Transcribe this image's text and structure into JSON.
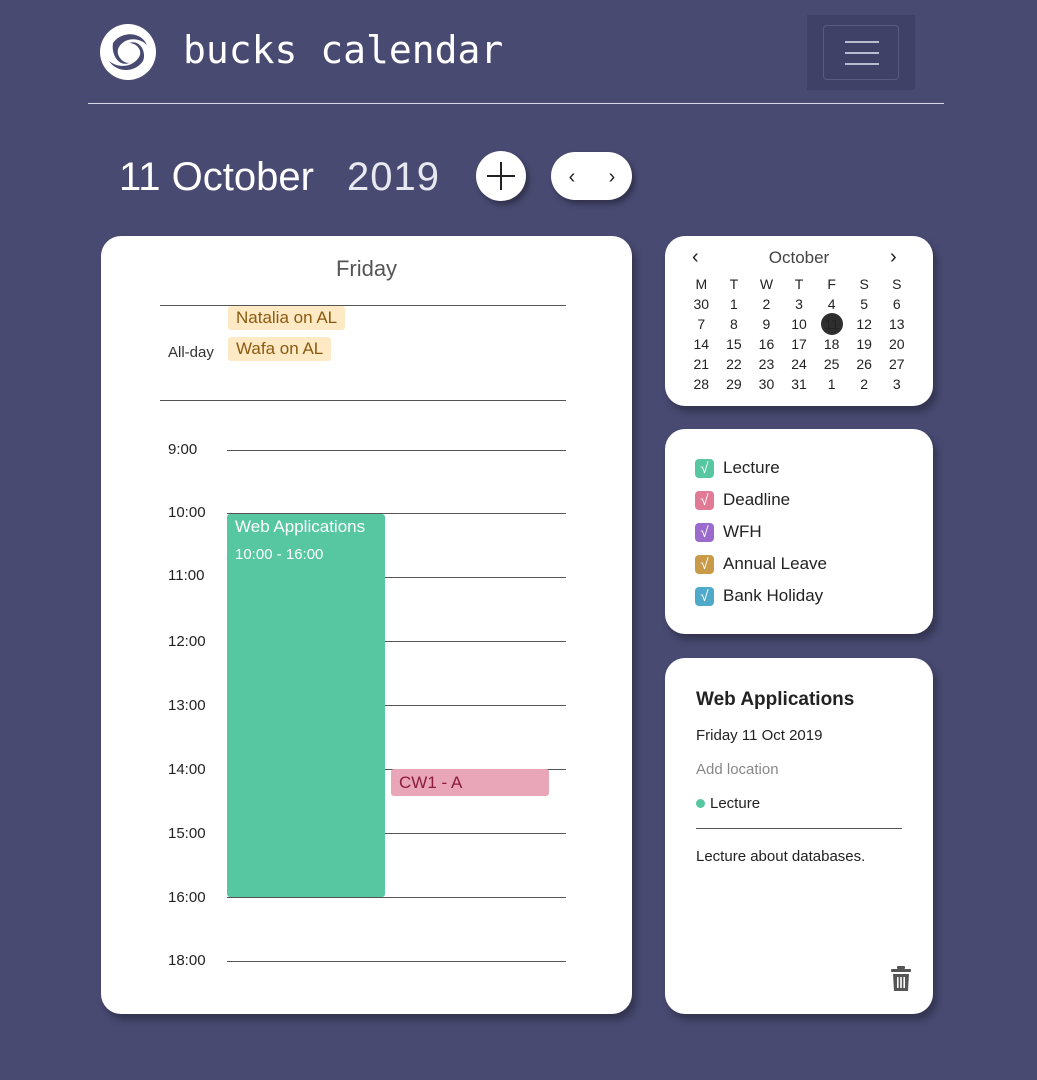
{
  "header": {
    "app_title": "bucks calendar",
    "logo_icon": "bucks-logo-icon",
    "menu_icon": "hamburger-menu-icon"
  },
  "date_heading": {
    "day_month": "11 October",
    "year": "2019",
    "add_icon": "plus-icon",
    "prev_icon": "chevron-left-icon",
    "next_icon": "chevron-right-icon",
    "prev_glyph": "‹",
    "next_glyph": "›"
  },
  "day_view": {
    "day_name": "Friday",
    "allday_label": "All-day",
    "allday_events": [
      {
        "label": "Natalia on AL"
      },
      {
        "label": "Wafa on AL"
      }
    ],
    "time_labels": [
      "9:00",
      "10:00",
      "11:00",
      "12:00",
      "13:00",
      "14:00",
      "15:00",
      "16:00",
      "18:00"
    ],
    "events": [
      {
        "title": "Web Applications",
        "time": "10:00 - 16:00",
        "category": "Lecture"
      },
      {
        "title": "CW1 - A",
        "category": "Deadline"
      }
    ]
  },
  "mini_calendar": {
    "month": "October",
    "prev_glyph": "‹",
    "next_glyph": "›",
    "weekdays": [
      "M",
      "T",
      "W",
      "T",
      "F",
      "S",
      "S"
    ],
    "weeks": [
      [
        "30",
        "1",
        "2",
        "3",
        "4",
        "5",
        "6"
      ],
      [
        "7",
        "8",
        "9",
        "10",
        "11",
        "12",
        "13"
      ],
      [
        "14",
        "15",
        "16",
        "17",
        "18",
        "19",
        "20"
      ],
      [
        "21",
        "22",
        "23",
        "24",
        "25",
        "26",
        "27"
      ],
      [
        "28",
        "29",
        "30",
        "31",
        "1",
        "2",
        "3"
      ]
    ],
    "today": "11"
  },
  "legend": {
    "check_glyph": "√",
    "items": [
      {
        "label": "Lecture",
        "color": "#56c7a1"
      },
      {
        "label": "Deadline",
        "color": "#e07a95"
      },
      {
        "label": "WFH",
        "color": "#9a6bcc"
      },
      {
        "label": "Annual Leave",
        "color": "#c99a48"
      },
      {
        "label": "Bank Holiday",
        "color": "#4fa9c9"
      }
    ]
  },
  "event_detail": {
    "title": "Web Applications",
    "date": "Friday 11 Oct 2019",
    "location_placeholder": "Add location",
    "category": "Lecture",
    "category_color": "#56c7a1",
    "description": "Lecture about databases.",
    "delete_icon": "trash-icon"
  },
  "colors": {
    "background": "#484a72",
    "lecture": "#56c7a1",
    "deadline_fill": "#e9a6b9",
    "annual_leave_fill": "#fde9c4",
    "holiday_text": "#e0577a"
  }
}
